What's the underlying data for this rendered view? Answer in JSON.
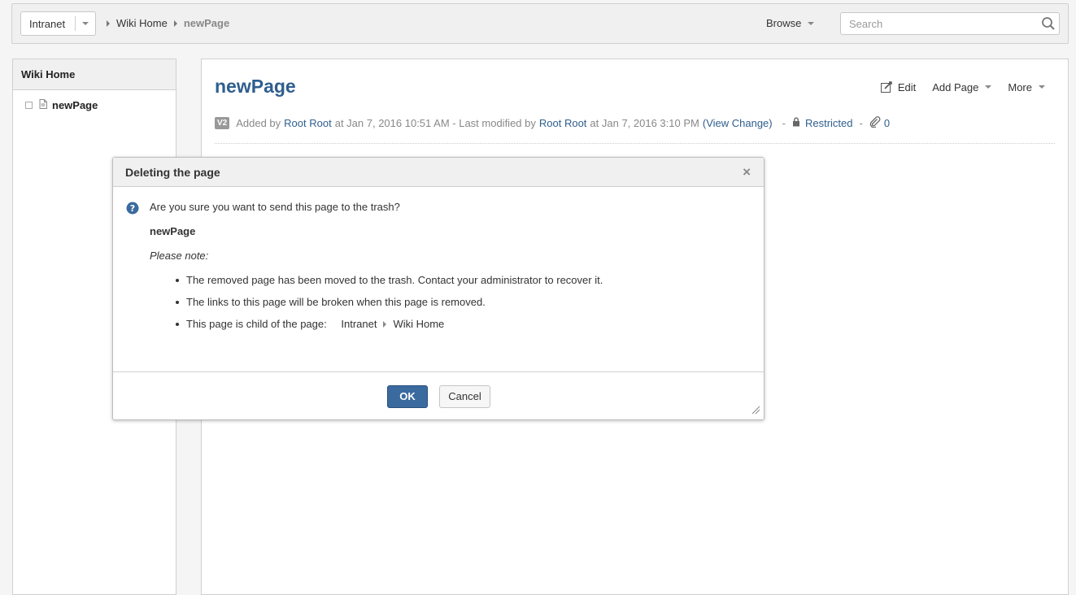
{
  "topbar": {
    "space_name": "Intranet",
    "breadcrumb": [
      "Wiki Home",
      "newPage"
    ],
    "browse_label": "Browse",
    "search_placeholder": "Search"
  },
  "sidebar": {
    "title": "Wiki Home",
    "items": [
      {
        "label": "newPage"
      }
    ]
  },
  "page": {
    "title": "newPage",
    "actions": {
      "edit": "Edit",
      "add_page": "Add Page",
      "more": "More"
    },
    "meta": {
      "version": "V2",
      "added_by_prefix": "Added by",
      "creator": "Root Root",
      "created_at": "at Jan 7, 2016 10:51 AM - Last modified by",
      "modifier": "Root Root",
      "modified_at": "at Jan 7, 2016 3:10 PM",
      "view_change": "(View Change)",
      "dash1": "-",
      "restricted": "Restricted",
      "dash2": "-",
      "attachments": "0"
    }
  },
  "dialog": {
    "title": "Deleting the page",
    "close_glyph": "×",
    "question": "Are you sure you want to send this page to the trash?",
    "page_name": "newPage",
    "note_label": "Please note:",
    "notes": [
      "The removed page has been moved to the trash. Contact your administrator to recover it.",
      "The links to this page will be broken when this page is removed.",
      "This page is child of the page:"
    ],
    "parent_path": [
      "Intranet",
      "Wiki Home"
    ],
    "ok_label": "OK",
    "cancel_label": "Cancel"
  }
}
